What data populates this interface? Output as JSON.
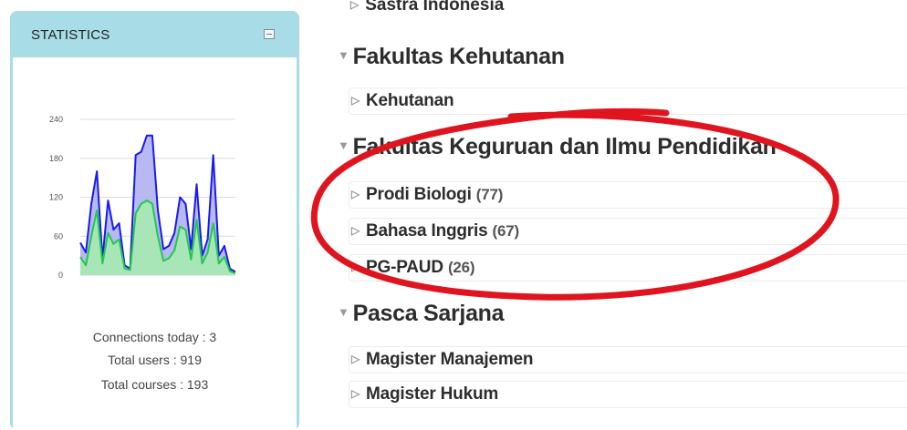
{
  "stats": {
    "title": "STATISTICS",
    "collapse_icon": "minus-square-icon",
    "connections_today": "Connections today : 3",
    "total_users": "Total users : 919",
    "total_courses": "Total courses : 193"
  },
  "chart_data": {
    "type": "area",
    "yticks": [
      "240",
      "180",
      "120",
      "60",
      "0"
    ],
    "ylim": [
      0,
      240
    ],
    "grid": true,
    "colors": {
      "series_1": "#1a1aee",
      "series_2": "#22c94a"
    },
    "series": [
      {
        "values": [
          50,
          35,
          110,
          160,
          25,
          115,
          70,
          80,
          15,
          10,
          185,
          190,
          215,
          215,
          100,
          40,
          45,
          65,
          120,
          110,
          40,
          140,
          30,
          55,
          185,
          30,
          45,
          10,
          5
        ]
      },
      {
        "values": [
          28,
          15,
          60,
          100,
          18,
          65,
          48,
          55,
          10,
          8,
          95,
          110,
          115,
          110,
          60,
          22,
          26,
          38,
          75,
          70,
          24,
          85,
          18,
          35,
          80,
          18,
          28,
          6,
          3
        ]
      }
    ]
  },
  "tree": {
    "top_item": "Sastra Indonesia",
    "faculties": [
      {
        "name": "Fakultas Kehutanan",
        "courses": [
          {
            "name": "Kehutanan",
            "count": ""
          }
        ]
      },
      {
        "name": "Fakultas Keguruan dan Ilmu Pendidikan",
        "courses": [
          {
            "name": "Prodi Biologi",
            "count": "(77)"
          },
          {
            "name": "Bahasa Inggris",
            "count": "(67)"
          },
          {
            "name": "PG-PAUD",
            "count": "(26)"
          }
        ]
      },
      {
        "name": "Pasca Sarjana",
        "courses": [
          {
            "name": "Magister Manajemen",
            "count": ""
          },
          {
            "name": "Magister Hukum",
            "count": ""
          }
        ]
      }
    ]
  },
  "highlight_color": "#e0141e"
}
